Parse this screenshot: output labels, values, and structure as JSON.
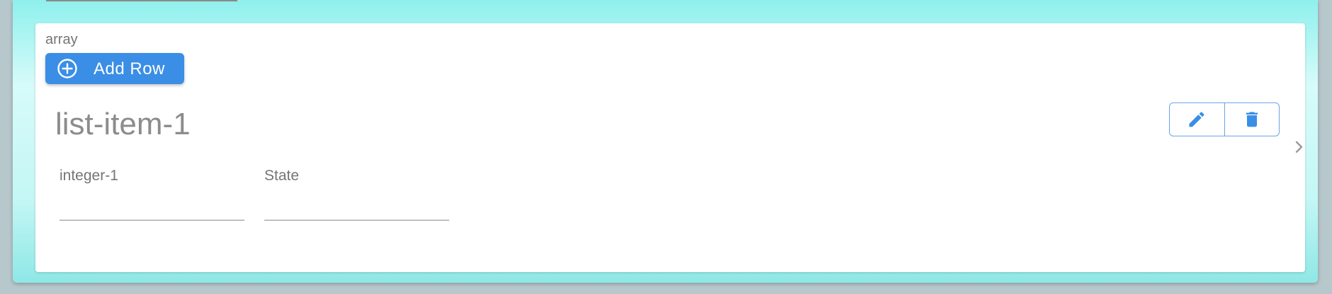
{
  "array_label": "array",
  "add_row": {
    "label": "Add Row",
    "icon": "plus-circle-icon"
  },
  "item": {
    "title": "list-item-1",
    "actions": [
      {
        "name": "edit",
        "icon": "pencil-icon"
      },
      {
        "name": "delete",
        "icon": "trash-icon"
      }
    ],
    "fields": [
      {
        "label": "integer-1",
        "value": ""
      },
      {
        "label": "State",
        "value": ""
      }
    ]
  },
  "colors": {
    "accent": "#3a8ee6",
    "background_gradient": "#a6f4f1",
    "text_muted": "#757575"
  }
}
